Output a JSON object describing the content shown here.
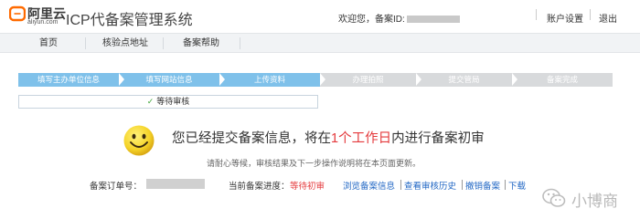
{
  "brand": {
    "logo_cn": "阿里云",
    "logo_en": "aliyun.com",
    "site_title": "ICP代备案管理系统"
  },
  "user_bar": {
    "welcome": "欢迎您，备案ID:",
    "account_settings": "账户设置",
    "logout": "退出"
  },
  "nav": {
    "items": [
      {
        "label": "首页"
      },
      {
        "label": "核验点地址"
      },
      {
        "label": "备案帮助"
      }
    ]
  },
  "steps": [
    {
      "label": "填写主办单位信息",
      "state": "done"
    },
    {
      "label": "填写网站信息",
      "state": "done"
    },
    {
      "label": "上传资料",
      "state": "done"
    },
    {
      "label": "办理拍照",
      "state": "todo"
    },
    {
      "label": "提交管局",
      "state": "todo"
    },
    {
      "label": "备案完成",
      "state": "todo"
    }
  ],
  "status": {
    "check_glyph": "✓",
    "label": "等待审核"
  },
  "message": {
    "part1": "您已经提交备案信息，将在",
    "highlight": "1个工作日",
    "part2": "内进行备案初审",
    "sub": "请耐心等候，审核结果及下一步操作说明将在本页面更新。"
  },
  "order": {
    "label": "备案订单号："
  },
  "progress": {
    "label": "当前备案进度：",
    "value": "等待初审"
  },
  "actions": [
    {
      "label": "浏览备案信息"
    },
    {
      "label": "查看审核历史"
    },
    {
      "label": "撤销备案"
    },
    {
      "label": "下载"
    }
  ],
  "watermark": {
    "text": "小博商"
  },
  "colors": {
    "step_done": "#7fc1ea",
    "step_todo": "#d8dadc",
    "link": "#2167c4",
    "highlight": "#e4393c",
    "check": "#41a63a",
    "smiley": "#f5d327"
  }
}
